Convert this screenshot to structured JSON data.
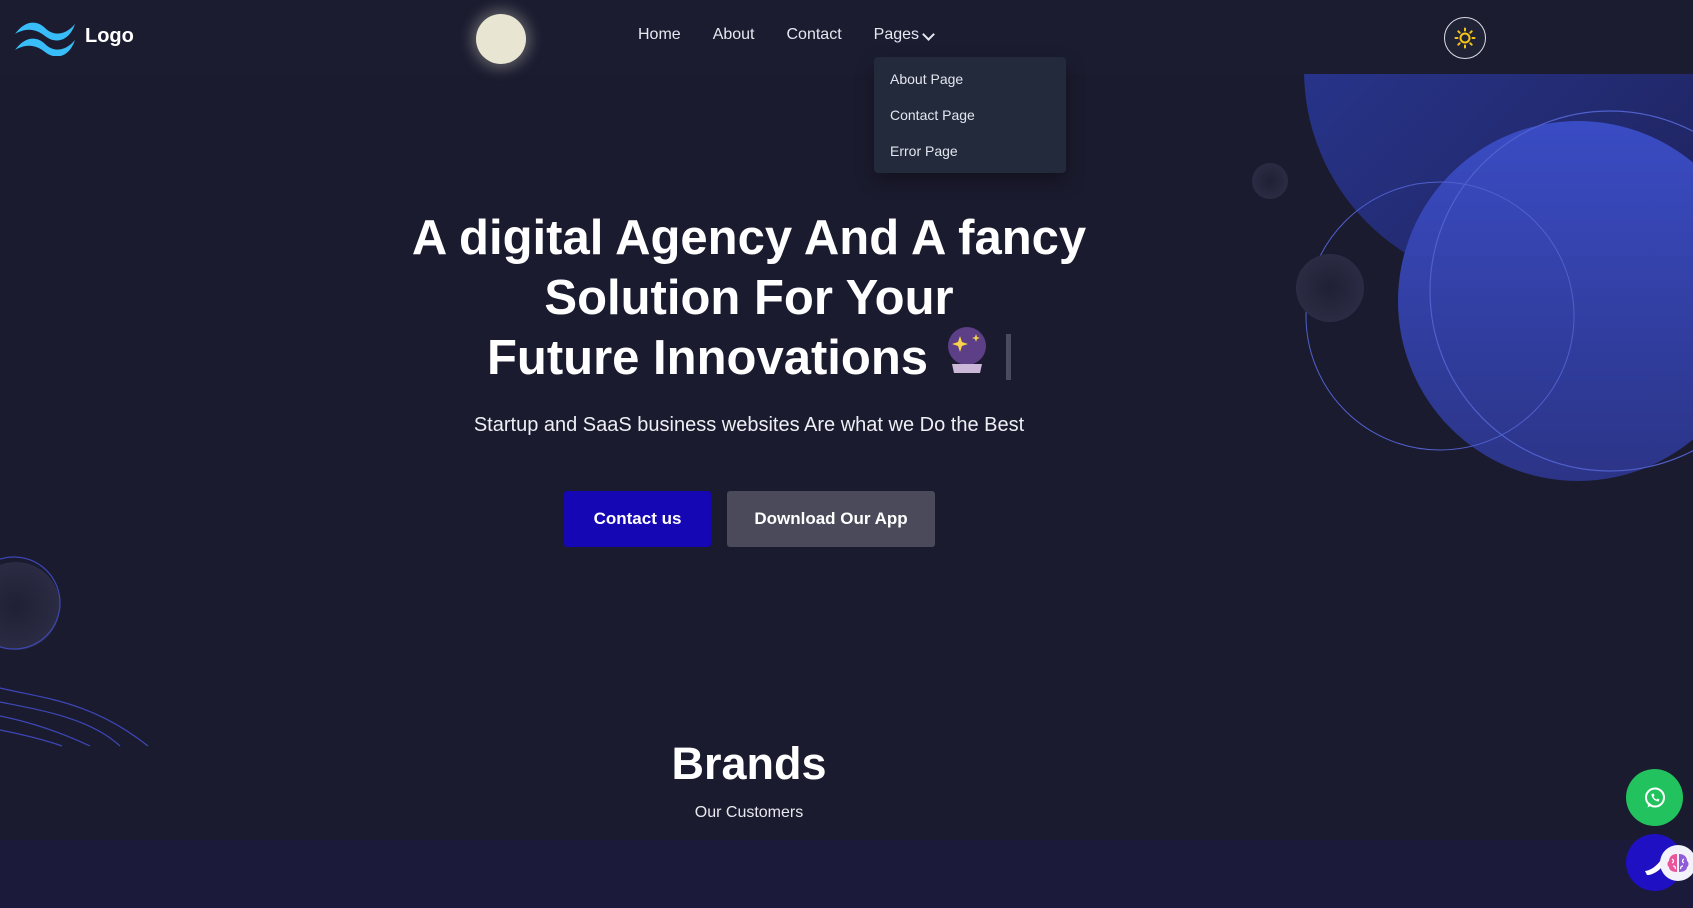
{
  "header": {
    "logo_text": "Logo",
    "nav": {
      "home": "Home",
      "about": "About",
      "contact": "Contact",
      "pages": "Pages"
    },
    "pages_dropdown": [
      "About Page",
      "Contact Page",
      "Error Page"
    ]
  },
  "hero": {
    "title_lines": [
      "A digital Agency And A fancy",
      "Solution For Your",
      "Future Innovations"
    ],
    "subtitle": "Startup and SaaS business websites Are what we Do the Best",
    "contact_button": "Contact us",
    "download_button": "Download Our App"
  },
  "brands": {
    "title": "Brands",
    "subtitle": "Our Customers"
  },
  "icons": {
    "logo": "wave-logo-icon",
    "moon": "moon-icon",
    "theme_toggle": "sun-icon",
    "hero_emoji": "crystal-ball-icon",
    "whatsapp": "whatsapp-icon",
    "phone": "phone-icon",
    "brain": "brain-icon"
  },
  "colors": {
    "background": "#1b1b2f",
    "primary_button": "#1607b4",
    "secondary_button": "#4a4a5a",
    "whatsapp_green": "#22c35e",
    "logo_blue": "#38bdf8",
    "accent_blue": "#3b4cc0"
  }
}
